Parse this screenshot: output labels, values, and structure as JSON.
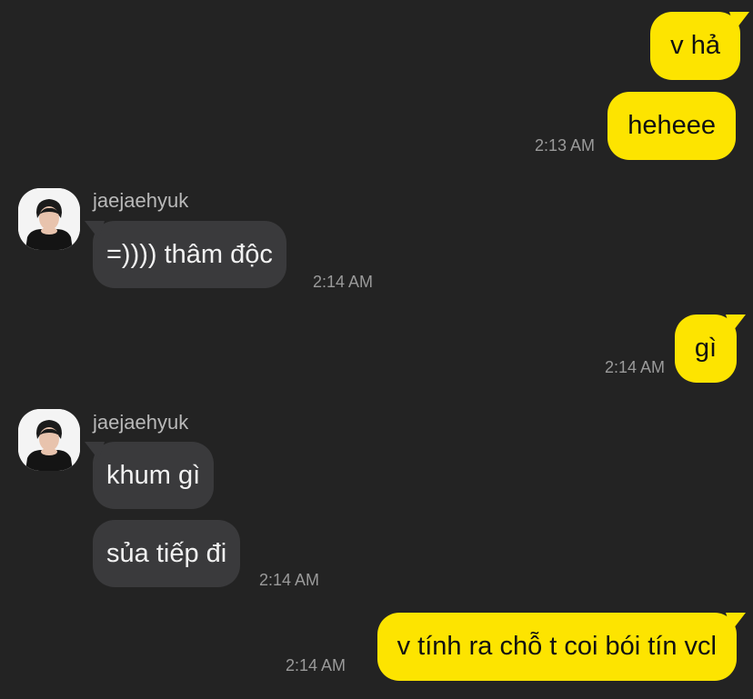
{
  "chat": {
    "messages": [
      {
        "text": "v hả"
      },
      {
        "text": "heheee",
        "time": "2:13 AM"
      },
      {
        "sender": "jaejaehyuk",
        "text": "=)))) thâm độc",
        "time": "2:14 AM",
        "avatar_icon": "user-avatar-icon"
      },
      {
        "text": "gì",
        "time": "2:14 AM"
      },
      {
        "sender": "jaejaehyuk",
        "text": "khum gì",
        "avatar_icon": "user-avatar-icon"
      },
      {
        "text": "sủa tiếp đi",
        "time": "2:14 AM"
      },
      {
        "text": "v tính ra chỗ t coi bói tín vcl",
        "time": "2:14 AM"
      }
    ]
  },
  "colors": {
    "background": "#232323",
    "outgoing_bubble": "#fde400",
    "incoming_bubble": "#3a3a3c",
    "timestamp": "#9a9a9a",
    "sender_name": "#b9b9b9"
  }
}
